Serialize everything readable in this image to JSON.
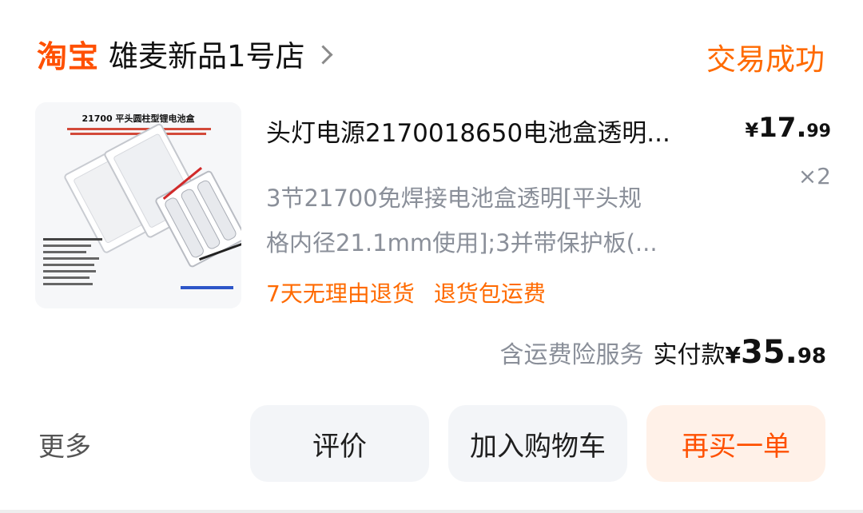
{
  "header": {
    "logo_text": "淘宝",
    "shop_name": "雄麦新品1号店",
    "status": "交易成功"
  },
  "product": {
    "image_title": "21700 平头圆柱型锂电池盒",
    "title": "头灯电源2170018650电池盒透明...",
    "price_symbol": "¥",
    "price_int": "17.",
    "price_dec": "99",
    "quantity": "×2",
    "spec_line1": "3节21700免焊接电池盒透明[平头规",
    "spec_line2": "格内径21.1mm使用];3并带保护板(...",
    "tags": [
      "7天无理由退货",
      "退货包运费"
    ]
  },
  "summary": {
    "insurance": "含运费险服务",
    "paid_label": "实付款",
    "paid_symbol": "¥",
    "paid_int": "35.",
    "paid_dec": "98"
  },
  "actions": {
    "more": "更多",
    "review": "评价",
    "add_to_cart": "加入购物车",
    "rebuy": "再买一单"
  },
  "colors": {
    "brand": "#ff5000",
    "status": "#ff6a00",
    "muted": "#8a8f99"
  }
}
